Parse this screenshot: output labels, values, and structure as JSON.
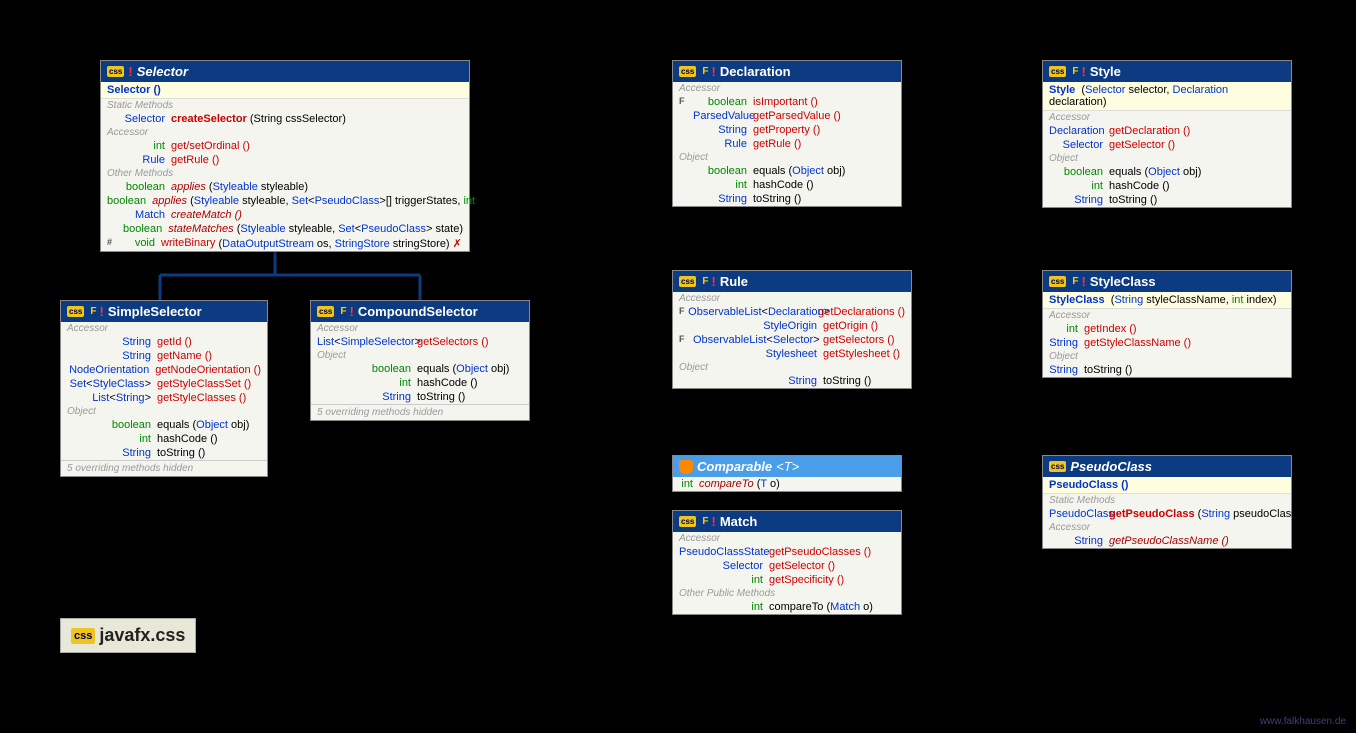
{
  "package": "javafx.css",
  "watermark": "www.falkhausen.de",
  "selector": {
    "title": "Selector",
    "ctor": "Selector ()",
    "secStatic": "Static Methods",
    "createSelector": {
      "ret": "Selector",
      "name": "createSelector",
      "params": "(String cssSelector)"
    },
    "secAccessor": "Accessor",
    "getsetOrdinal": {
      "ret": "int",
      "name": "get/setOrdinal ()"
    },
    "getRule": {
      "ret": "Rule",
      "name": "getRule ()"
    },
    "secOther": "Other Methods",
    "applies1": {
      "ret": "boolean",
      "name": "applies",
      "params": "(Styleable styleable)"
    },
    "applies2": {
      "ret": "boolean",
      "name": "applies",
      "params": "(Styleable styleable, Set<PseudoClass>[] triggerStates, int bit)"
    },
    "createMatch": {
      "ret": "Match",
      "name": "createMatch ()"
    },
    "stateMatches": {
      "ret": "boolean",
      "name": "stateMatches",
      "params": "(Styleable styleable, Set<PseudoClass> state)"
    },
    "writeBinary": {
      "mod": "#",
      "ret": "void",
      "name": "writeBinary",
      "params": "(DataOutputStream os, StringStore stringStore)",
      "throws": "✗"
    }
  },
  "simpleSelector": {
    "title": "SimpleSelector",
    "secAccessor": "Accessor",
    "getId": {
      "ret": "String",
      "name": "getId ()"
    },
    "getName": {
      "ret": "String",
      "name": "getName ()"
    },
    "getNodeOrientation": {
      "ret": "NodeOrientation",
      "name": "getNodeOrientation ()"
    },
    "getStyleClassSet": {
      "ret": "Set<StyleClass>",
      "name": "getStyleClassSet ()"
    },
    "getStyleClasses": {
      "ret": "List<String>",
      "name": "getStyleClasses ()"
    },
    "secObject": "Object",
    "equals": {
      "ret": "boolean",
      "name": "equals",
      "params": "(Object obj)"
    },
    "hashCode": {
      "ret": "int",
      "name": "hashCode ()"
    },
    "toString": {
      "ret": "String",
      "name": "toString ()"
    },
    "footer": "5 overriding methods hidden"
  },
  "compoundSelector": {
    "title": "CompoundSelector",
    "secAccessor": "Accessor",
    "getSelectors": {
      "ret": "List<SimpleSelector>",
      "name": "getSelectors ()"
    },
    "secObject": "Object",
    "equals": {
      "ret": "boolean",
      "name": "equals",
      "params": "(Object obj)"
    },
    "hashCode": {
      "ret": "int",
      "name": "hashCode ()"
    },
    "toString": {
      "ret": "String",
      "name": "toString ()"
    },
    "footer": "5 overriding methods hidden"
  },
  "declaration": {
    "title": "Declaration",
    "secAccessor": "Accessor",
    "isImportant": {
      "mod": "F",
      "ret": "boolean",
      "name": "isImportant ()"
    },
    "getParsedValue": {
      "ret": "ParsedValue",
      "name": "getParsedValue ()"
    },
    "getProperty": {
      "ret": "String",
      "name": "getProperty ()"
    },
    "getRule": {
      "ret": "Rule",
      "name": "getRule ()"
    },
    "secObject": "Object",
    "equals": {
      "ret": "boolean",
      "name": "equals",
      "params": "(Object obj)"
    },
    "hashCode": {
      "ret": "int",
      "name": "hashCode ()"
    },
    "toString": {
      "ret": "String",
      "name": "toString ()"
    }
  },
  "rule": {
    "title": "Rule",
    "secAccessor": "Accessor",
    "getDeclarations": {
      "mod": "F",
      "ret": "ObservableList<Declaration>",
      "name": "getDeclarations ()"
    },
    "getOrigin": {
      "ret": "StyleOrigin",
      "name": "getOrigin ()"
    },
    "getSelectors": {
      "mod": "F",
      "ret": "ObservableList<Selector>",
      "name": "getSelectors ()"
    },
    "getStylesheet": {
      "ret": "Stylesheet",
      "name": "getStylesheet ()"
    },
    "secObject": "Object",
    "toString": {
      "ret": "String",
      "name": "toString ()"
    }
  },
  "comparable": {
    "title": "Comparable",
    "typeparam": "<T>",
    "compareTo": {
      "ret": "int",
      "name": "compareTo",
      "params": "(T o)"
    }
  },
  "match": {
    "title": "Match",
    "secAccessor": "Accessor",
    "getPseudoClasses": {
      "ret": "PseudoClassState",
      "name": "getPseudoClasses ()"
    },
    "getSelector": {
      "ret": "Selector",
      "name": "getSelector ()"
    },
    "getSpecificity": {
      "ret": "int",
      "name": "getSpecificity ()"
    },
    "secOther": "Other Public Methods",
    "compareTo": {
      "ret": "int",
      "name": "compareTo",
      "params": "(Match o)"
    }
  },
  "style": {
    "title": "Style",
    "ctor": {
      "name": "Style",
      "params": "(Selector selector, Declaration declaration)"
    },
    "secAccessor": "Accessor",
    "getDeclaration": {
      "ret": "Declaration",
      "name": "getDeclaration ()"
    },
    "getSelector": {
      "ret": "Selector",
      "name": "getSelector ()"
    },
    "secObject": "Object",
    "equals": {
      "ret": "boolean",
      "name": "equals",
      "params": "(Object obj)"
    },
    "hashCode": {
      "ret": "int",
      "name": "hashCode ()"
    },
    "toString": {
      "ret": "String",
      "name": "toString ()"
    }
  },
  "styleClass": {
    "title": "StyleClass",
    "ctor": {
      "name": "StyleClass",
      "params": "(String styleClassName, int index)"
    },
    "secAccessor": "Accessor",
    "getIndex": {
      "ret": "int",
      "name": "getIndex ()"
    },
    "getStyleClassName": {
      "ret": "String",
      "name": "getStyleClassName ()"
    },
    "secObject": "Object",
    "toString": {
      "ret": "String",
      "name": "toString ()"
    }
  },
  "pseudoClass": {
    "title": "PseudoClass",
    "ctor": "PseudoClass ()",
    "secStatic": "Static Methods",
    "getPseudoClass": {
      "ret": "PseudoClass",
      "name": "getPseudoClass",
      "params": "(String pseudoClass)"
    },
    "secAccessor": "Accessor",
    "getPseudoClassName": {
      "ret": "String",
      "name": "getPseudoClassName ()"
    }
  }
}
